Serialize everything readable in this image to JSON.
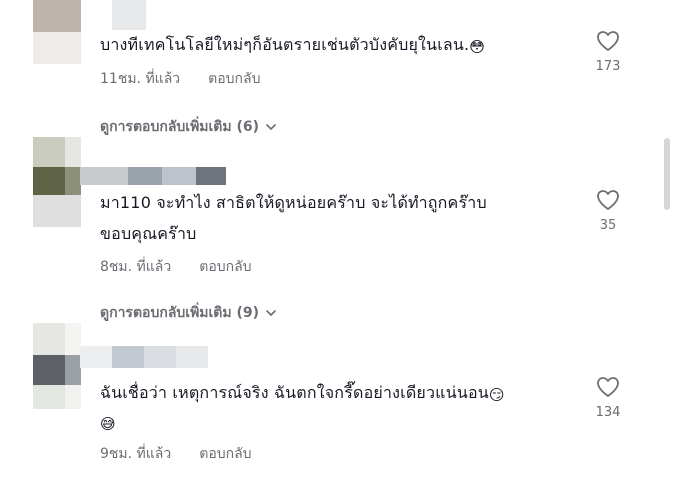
{
  "comments": [
    {
      "text": "บางทีเทคโนโลยีใหม่ๆก็อันตรายเช่นตัวบังคับยุในเลน.",
      "emoji": "😳",
      "time": "11ชม. ที่แล้ว",
      "reply_label": "ตอบกลับ",
      "likes": "173",
      "more_replies": "ดูการตอบกลับเพิ่มเติม (6)"
    },
    {
      "text_line1": "มา110 จะทำไง สาธิตให้ดูหน่อยคร๊าบ จะได้ทำถูกคร๊าบ",
      "text_line2": "ขอบคุณคร๊าบ",
      "time": "8ชม. ที่แล้ว",
      "reply_label": "ตอบกลับ",
      "likes": "35",
      "more_replies": "ดูการตอบกลับเพิ่มเติม (9)"
    },
    {
      "text": "ฉันเชื่อว่า เหตุการณ์จริง ฉันตกใจกรี๊ดอย่างเดียวแน่นอน",
      "emoji_inline": "😏",
      "emoji_line2": "😅",
      "time": "9ชม. ที่แล้ว",
      "reply_label": "ตอบกลับ",
      "likes": "134"
    }
  ],
  "icons": {
    "like": "heart-outline-icon",
    "expand": "chevron-down-icon"
  },
  "colors": {
    "text": "#161823",
    "muted": "#6b6d73",
    "icon": "#6b6d73"
  }
}
